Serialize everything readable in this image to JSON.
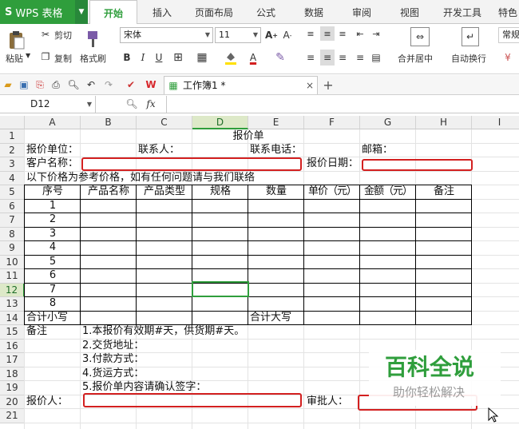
{
  "app": {
    "logo": "S",
    "name": "WPS 表格"
  },
  "tabs": [
    "开始",
    "插入",
    "页面布局",
    "公式",
    "数据",
    "审阅",
    "视图",
    "开发工具",
    "特色"
  ],
  "ribbon": {
    "paste": "粘贴",
    "cut": "剪切",
    "copy": "复制",
    "format_painter": "格式刷",
    "font": "宋体",
    "size": "11",
    "bold": "B",
    "italic": "I",
    "underline": "U",
    "font_color": "A",
    "merge": "合并居中",
    "wrap": "自动换行",
    "normal": "常规"
  },
  "doc": {
    "name": "工作簿1 *",
    "close": "×",
    "new": "+"
  },
  "formula": {
    "cell": "D12",
    "fx": "fx"
  },
  "columns": [
    "A",
    "B",
    "C",
    "D",
    "E",
    "F",
    "G",
    "H",
    "I"
  ],
  "rows": [
    "1",
    "2",
    "3",
    "4",
    "5",
    "6",
    "7",
    "8",
    "9",
    "10",
    "11",
    "12",
    "13",
    "14",
    "15",
    "16",
    "17",
    "18",
    "19",
    "20",
    "21"
  ],
  "selected": {
    "col": "D",
    "row": "12"
  },
  "cells": {
    "title": "报价单",
    "quote_unit": "报价单位：",
    "contact": "联系人：",
    "phone": "联系电话：",
    "email": "邮箱：",
    "client": "客户名称：",
    "quote_date": "报价日期：",
    "note_line": "以下价格为参考价格，如有任何问题请与我们联络",
    "headers": [
      "序号",
      "产品名称",
      "产品类型",
      "规格",
      "数量",
      "单价（元）",
      "金额（元）",
      "备注"
    ],
    "seq": [
      "1",
      "2",
      "3",
      "4",
      "5",
      "6",
      "7",
      "8"
    ],
    "subtotal": "合计小写",
    "total_upper": "合计大写",
    "remark": "备注",
    "terms": [
      "1.本报价有效期#天，供货期#天。",
      "2.交货地址：",
      "3.付款方式：",
      "4.货运方式：",
      "5.报价单内容请确认签字："
    ],
    "quoter": "报价人：",
    "approver": "审批人："
  },
  "watermark": {
    "main": "百科全说",
    "sub": "助你轻松解决"
  },
  "colors": {
    "accent": "#2f9e3c",
    "red": "#d32020",
    "wps_red": "#d7262b"
  }
}
